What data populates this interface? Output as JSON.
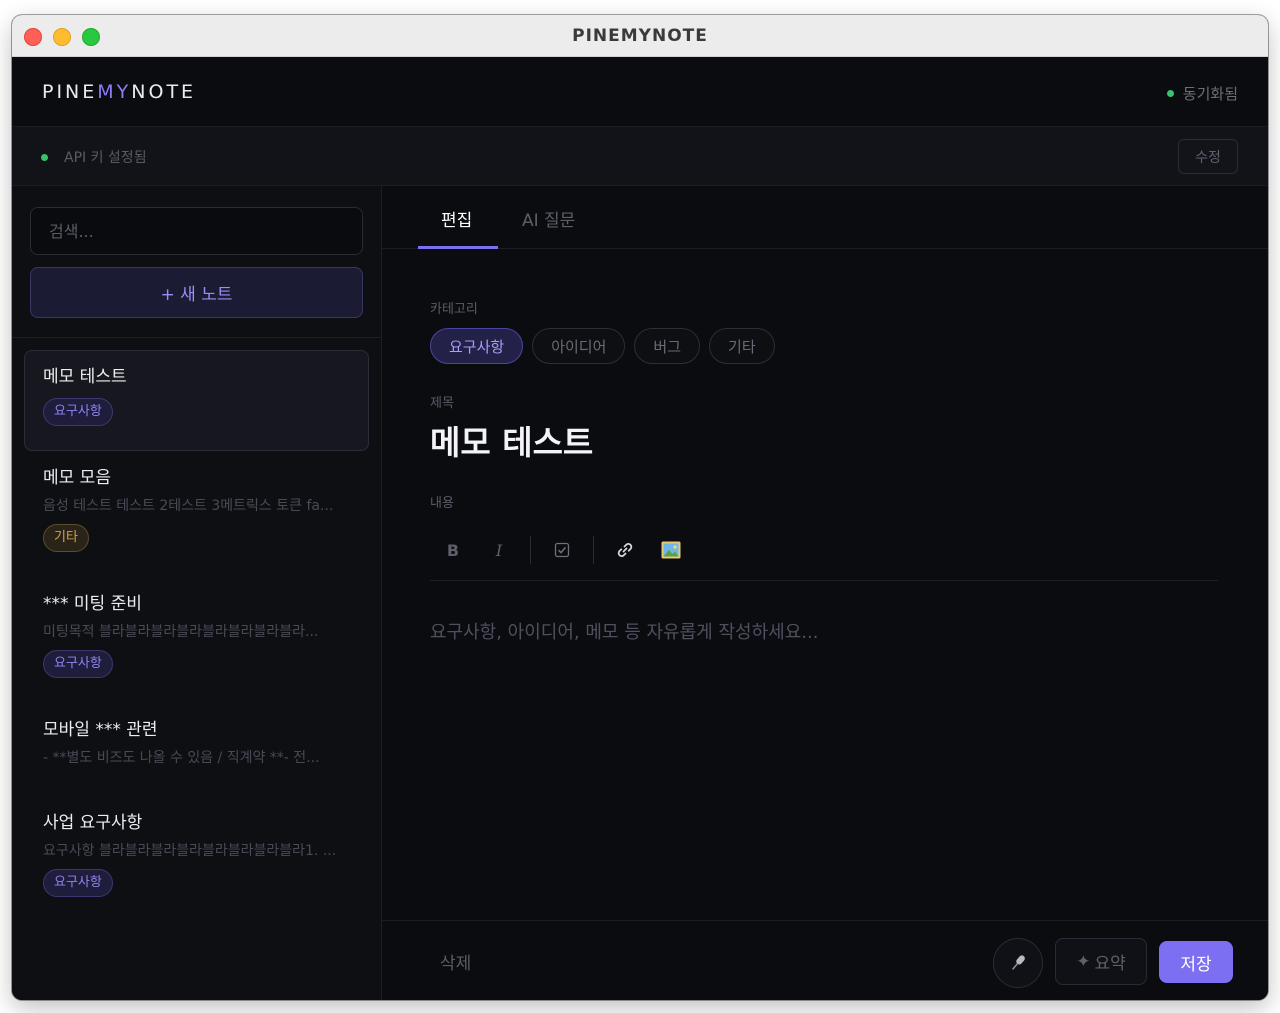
{
  "window": {
    "title": "PINEMYNOTE"
  },
  "header": {
    "logo_part1": "PINE",
    "logo_accent": "MY",
    "logo_part2": "NOTE",
    "sync_status": "동기화됨"
  },
  "api_bar": {
    "status": "API 키 설정됨",
    "edit_label": "수정"
  },
  "sidebar": {
    "search_placeholder": "검색...",
    "new_note_label": "+ 새 노트",
    "notes": [
      {
        "title": "메모 테스트",
        "preview": "",
        "tag": "요구사항"
      },
      {
        "title": "메모 모음",
        "preview": "음성 테스트 테스트 2테스트 3메트릭스 토큰 fa...",
        "tag": "기타"
      },
      {
        "title": "*** 미팅 준비",
        "preview": "미팅목적 블라블라블라블라블라블라블라블라...",
        "tag": "요구사항"
      },
      {
        "title": "모바일 *** 관련",
        "preview": "- **별도 비즈도 나올 수 있음 / 직계약 **- 전...",
        "tag": ""
      },
      {
        "title": "사업 요구사항",
        "preview": "요구사항 블라블라블라블라블라블라블라블라1. ...",
        "tag": "요구사항"
      }
    ]
  },
  "editor": {
    "tabs": [
      {
        "label": "편집"
      },
      {
        "label": "AI 질문"
      }
    ],
    "category_label": "카테고리",
    "categories": [
      "요구사항",
      "아이디어",
      "버그",
      "기타"
    ],
    "selected_category": "요구사항",
    "title_label": "제목",
    "title_value": "메모 테스트",
    "content_label": "내용",
    "content_placeholder": "요구사항, 아이디어, 메모 등 자유롭게 작성하세요...",
    "toolbar": {
      "bold": "B",
      "italic": "I",
      "checkbox": "☑",
      "link": "🔗",
      "image": "🖼"
    }
  },
  "footer": {
    "delete_label": "삭제",
    "summary_label": "요약",
    "save_label": "저장",
    "mic_icon": "🎤",
    "sparkle_icon": "✦"
  },
  "colors": {
    "accent": "#7c6ff2",
    "status_green": "#37c46e",
    "background": "#0b0c0f"
  }
}
